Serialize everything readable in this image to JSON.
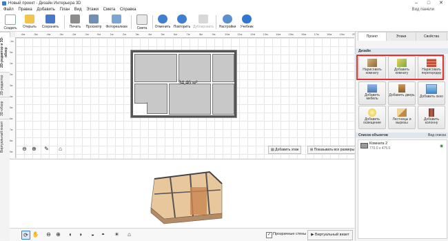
{
  "window": {
    "title": "Новый проект - Дизайн Интерьера 3D",
    "controls": {
      "minimize": "–",
      "maximize": "□",
      "close": "✕"
    }
  },
  "menu": {
    "items": [
      "Файл",
      "Правка",
      "Добавить",
      "План",
      "Вид",
      "Этажи",
      "Смета",
      "Справка"
    ],
    "right_label": "Вид панели"
  },
  "toolbar": {
    "buttons": [
      {
        "label": "Создать",
        "icon": "new-document-icon"
      },
      {
        "label": "Открыть",
        "icon": "folder-icon"
      },
      {
        "label": "Сохранить",
        "icon": "save-icon"
      },
      {
        "label": "Печать",
        "icon": "printer-icon"
      },
      {
        "label": "Просмотр",
        "icon": "preview-icon"
      },
      {
        "label": "Фотореализм",
        "icon": "photo-icon"
      },
      {
        "label": "Смета",
        "icon": "estimate-icon"
      },
      {
        "label": "Отменить",
        "icon": "undo-icon"
      },
      {
        "label": "Повторить",
        "icon": "redo-icon"
      },
      {
        "label": "Дублировать",
        "icon": "duplicate-icon"
      },
      {
        "label": "Настройки",
        "icon": "settings-icon"
      },
      {
        "label": "Учебник",
        "icon": "help-icon"
      }
    ]
  },
  "left_tabs": [
    "2D-редактор и 3D-обзор",
    "2D-редактор",
    "3D-обзор",
    "Виртуальный визит"
  ],
  "ruler": {
    "top_ticks": [
      "-6м",
      "-5м",
      "-4м",
      "-3м",
      "-2м",
      "-1м",
      "0м",
      "1м",
      "2м",
      "3м",
      "4м",
      "5м",
      "6м",
      "7м",
      "8м",
      "9м",
      "10м",
      "11м",
      "12м",
      "13м",
      "14м",
      "15м",
      "16м",
      "17м",
      "18м",
      "19м",
      "20м"
    ],
    "left_ticks": [
      "-1м",
      "0м",
      "1м",
      "2м",
      "3м",
      "4м",
      "5м",
      "6м",
      "7м",
      "8м",
      "9м"
    ]
  },
  "plan": {
    "area_label": "34,46 м²",
    "add_floor_label": "Добавить этаж",
    "show_sizes_label": "Показывать все размеры"
  },
  "bottom_bar": {
    "transparent_walls_label": "Прозрачные стены",
    "transparent_walls_checked": true,
    "virtual_visit_label": "Виртуальный визит"
  },
  "right_panel": {
    "tabs": [
      "Проект",
      "Этажи",
      "Свойства"
    ],
    "active_tab": "Проект",
    "design_section": "Дизайн",
    "design_buttons": [
      {
        "label": "Нарисовать комнату",
        "icon": "draw-room-icon"
      },
      {
        "label": "Добавить комнату",
        "icon": "add-room-icon"
      },
      {
        "label": "Нарисовать перегородку",
        "icon": "wall-icon"
      },
      {
        "label": "Добавить мебель",
        "icon": "furniture-icon"
      },
      {
        "label": "Добавить дверь",
        "icon": "door-icon"
      },
      {
        "label": "Добавить окно",
        "icon": "window-icon"
      },
      {
        "label": "Добавить освещение",
        "icon": "lamp-icon"
      },
      {
        "label": "Лестницы и вырезы",
        "icon": "stairs-icon"
      },
      {
        "label": "Добавить колонну",
        "icon": "column-icon"
      }
    ],
    "objects_section": "Список объектов",
    "objects_view_label": "Вид списка",
    "objects": [
      {
        "name": "Комната 2",
        "size": "770.0 x 475.0"
      }
    ]
  },
  "colors": {
    "accent": "#3b7bd6",
    "highlight_box": "#e23030",
    "room_fill": "#c8c8c8"
  }
}
